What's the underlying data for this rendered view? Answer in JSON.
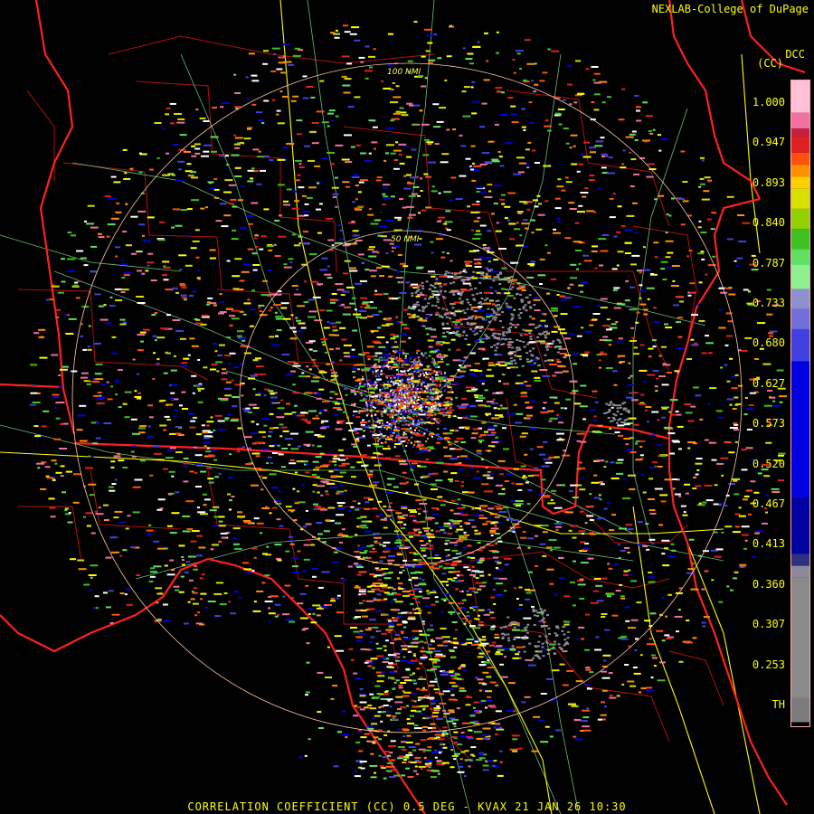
{
  "credit": "NEXLAB-College of DuPage",
  "product_short": "DCC",
  "product_units": "(CC)",
  "caption": "CORRELATION COEFFICIENT (CC) 0.5 DEG - KVAX 21 JAN 26 10:30",
  "range_rings": [
    {
      "label": "100 NMI",
      "radius_nmi": 100
    },
    {
      "label": "50 NMI",
      "radius_nmi": 50
    }
  ],
  "legend": {
    "ticks": [
      "1.000",
      "0.947",
      "0.893",
      "0.840",
      "0.787",
      "0.733",
      "0.680",
      "0.627",
      "0.573",
      "0.520",
      "0.467",
      "0.413",
      "0.360",
      "0.307",
      "0.253",
      "TH"
    ],
    "colors": [
      {
        "from": 1.0,
        "color": "#ffc0d8"
      },
      {
        "from": 0.98,
        "color": "#f070a0"
      },
      {
        "from": 0.96,
        "color": "#c8203c"
      },
      {
        "from": 0.95,
        "color": "#e02020"
      },
      {
        "from": 0.93,
        "color": "#ff5010"
      },
      {
        "from": 0.915,
        "color": "#ff9000"
      },
      {
        "from": 0.9,
        "color": "#ffd000"
      },
      {
        "from": 0.885,
        "color": "#d8e000"
      },
      {
        "from": 0.86,
        "color": "#90d000"
      },
      {
        "from": 0.835,
        "color": "#40c020"
      },
      {
        "from": 0.81,
        "color": "#60e060"
      },
      {
        "from": 0.79,
        "color": "#90f090"
      },
      {
        "from": 0.76,
        "color": "#9090d0"
      },
      {
        "from": 0.735,
        "color": "#7070d8"
      },
      {
        "from": 0.71,
        "color": "#4040e0"
      },
      {
        "from": 0.67,
        "color": "#0000e0"
      },
      {
        "from": 0.5,
        "color": "#0000a0"
      },
      {
        "from": 0.43,
        "color": "#303080"
      },
      {
        "from": 0.415,
        "color": "#8a8a9a"
      },
      {
        "from": 0.4,
        "color": "#8a8a8a"
      },
      {
        "from": 0.25,
        "color": "#7c7c7c"
      },
      {
        "from": 0.22,
        "color": "#000000"
      }
    ]
  },
  "colors": {
    "state_border": "#ff2020",
    "county_border": "#b01010",
    "highway": "#ffff00",
    "road": "#7fdf90",
    "ring": "#ffccaa",
    "text": "#ffff00"
  },
  "radar_site": "KVAX"
}
